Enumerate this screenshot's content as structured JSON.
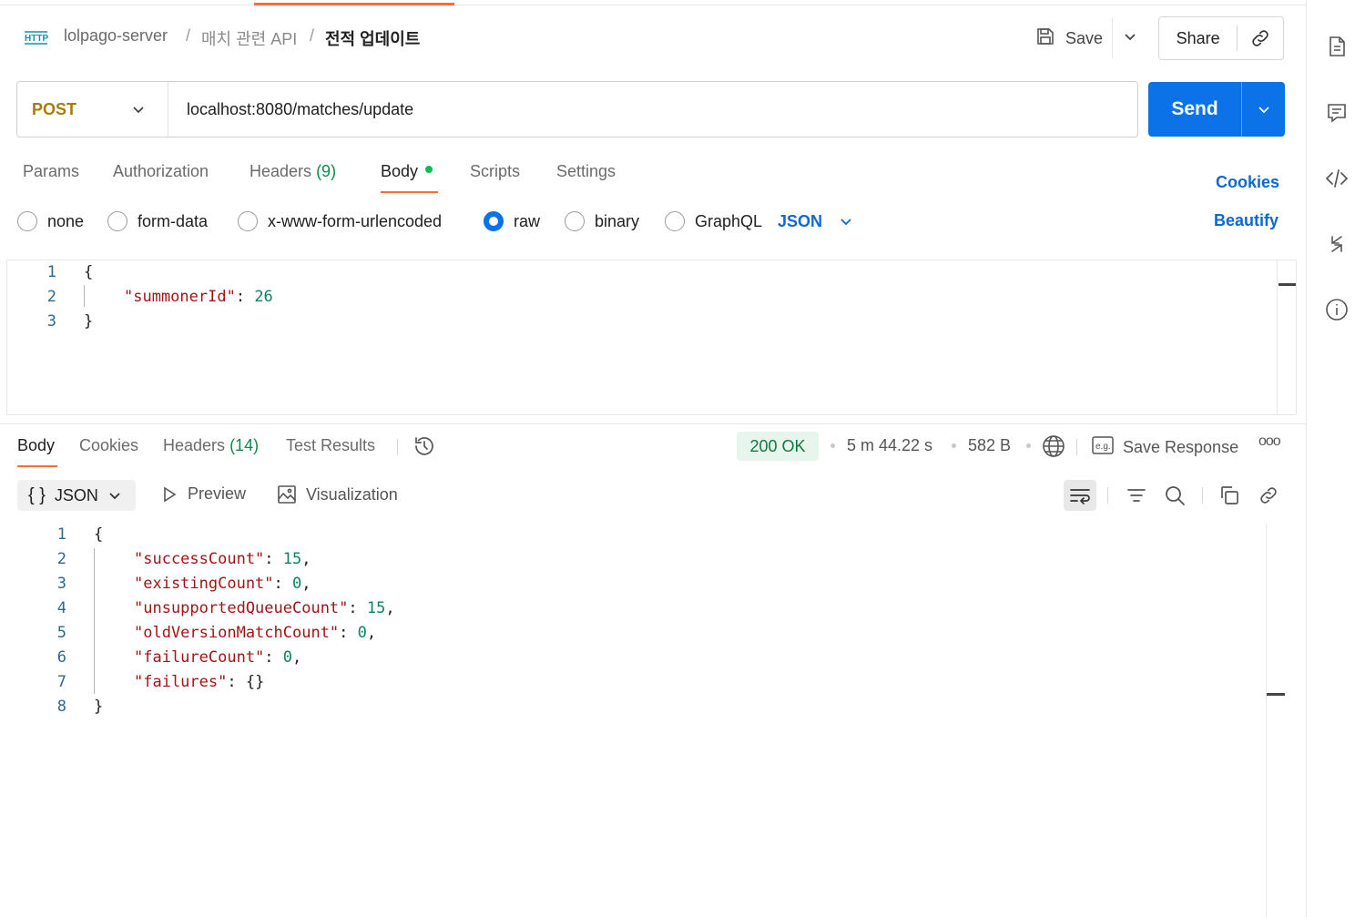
{
  "breadcrumb": {
    "icon": "http-icon",
    "collection": "lolpago-server",
    "folder": "매치 관련 API",
    "request": "전적 업데이트",
    "separator": "/"
  },
  "toolbar": {
    "save_label": "Save",
    "share_label": "Share"
  },
  "request": {
    "method": "POST",
    "url": "localhost:8080/matches/update",
    "send_label": "Send"
  },
  "request_tabs": [
    {
      "label": "Params"
    },
    {
      "label": "Authorization"
    },
    {
      "label": "Headers",
      "count": "(9)"
    },
    {
      "label": "Body",
      "active": true
    },
    {
      "label": "Scripts"
    },
    {
      "label": "Settings"
    }
  ],
  "cookies_link": "Cookies",
  "beautify_link": "Beautify",
  "body_types": [
    {
      "label": "none",
      "checked": false
    },
    {
      "label": "form-data",
      "checked": false
    },
    {
      "label": "x-www-form-urlencoded",
      "checked": false
    },
    {
      "label": "raw",
      "checked": true
    },
    {
      "label": "binary",
      "checked": false
    },
    {
      "label": "GraphQL",
      "checked": false
    }
  ],
  "raw_format": "JSON",
  "request_body": {
    "line_numbers": [
      "1",
      "2",
      "3"
    ],
    "open_brace": "{",
    "key": "\"summonerId\"",
    "colon": ": ",
    "value": "26",
    "close_brace": "}"
  },
  "response_tabs": [
    {
      "label": "Body",
      "active": true
    },
    {
      "label": "Cookies"
    },
    {
      "label": "Headers",
      "count": "(14)"
    },
    {
      "label": "Test Results"
    }
  ],
  "response_meta": {
    "status": "200 OK",
    "time": "5 m 44.22 s",
    "size": "582 B",
    "save_response": "Save Response",
    "more": "ooo"
  },
  "response_view": {
    "format_icon": "{ }",
    "format_label": "JSON",
    "preview_label": "Preview",
    "visualization_label": "Visualization"
  },
  "response_body": {
    "line_numbers": [
      "1",
      "2",
      "3",
      "4",
      "5",
      "6",
      "7",
      "8"
    ],
    "open_brace": "{",
    "close_brace": "}",
    "fields": [
      {
        "key": "\"successCount\"",
        "value": "15",
        "trail": ","
      },
      {
        "key": "\"existingCount\"",
        "value": "0",
        "trail": ","
      },
      {
        "key": "\"unsupportedQueueCount\"",
        "value": "15",
        "trail": ","
      },
      {
        "key": "\"oldVersionMatchCount\"",
        "value": "0",
        "trail": ","
      },
      {
        "key": "\"failureCount\"",
        "value": "0",
        "trail": ","
      },
      {
        "key": "\"failures\"",
        "value": "{}",
        "trail": ""
      }
    ]
  },
  "colors": {
    "accent": "#ff6c37",
    "send": "#0b72e7",
    "method": "#a97c05",
    "json_key": "#a31515",
    "json_number": "#098658",
    "status_bg": "#e7f6ec",
    "status_text": "#0e7a3e"
  }
}
